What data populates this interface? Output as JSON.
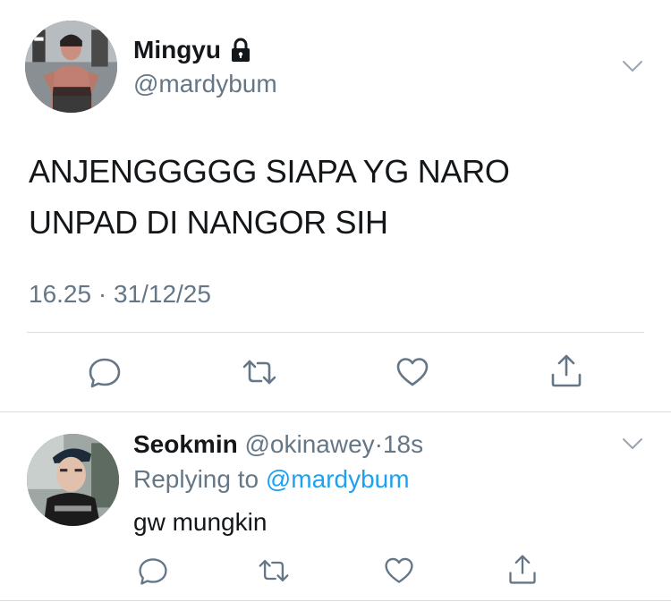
{
  "tweet": {
    "author_name": "Mingyu",
    "author_handle": "@mardybum",
    "text_line1": "ANJENGGGGG SIAPA YG NARO",
    "text_line2": "UNPAD DI NANGOR SIH",
    "timestamp": "16.25 · 31/12/25",
    "protected": true
  },
  "reply": {
    "author_name": "Seokmin",
    "author_handle": "@okinawey",
    "separator": "·",
    "age": "18s",
    "replying_prefix": "Replying to",
    "replying_to": "@mardybum",
    "text": "gw mungkin"
  },
  "icons": {
    "reply": "reply-icon",
    "retweet": "retweet-icon",
    "like": "heart-icon",
    "share": "share-icon",
    "more": "chevron-down-icon",
    "lock": "lock-icon"
  },
  "colors": {
    "text": "#14171a",
    "secondary": "#657786",
    "link": "#1da1f2",
    "icon": "#657786",
    "divider": "#d8dde1"
  }
}
